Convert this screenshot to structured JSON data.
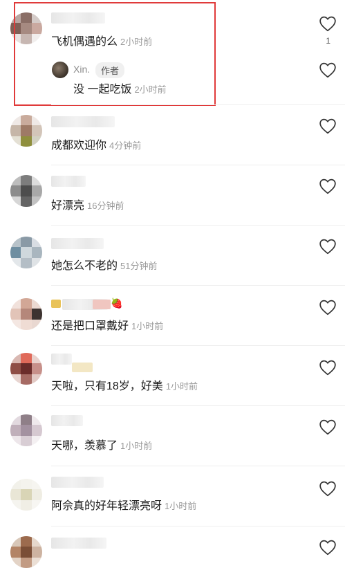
{
  "comments": [
    {
      "text": "飞机偶遇的么",
      "time": "2小时前",
      "likes": "1"
    },
    {
      "text": "成都欢迎你",
      "time": "4分钟前"
    },
    {
      "text": "好漂亮",
      "time": "16分钟前"
    },
    {
      "text": "她怎么不老的",
      "time": "51分钟前"
    },
    {
      "text": "还是把口罩戴好",
      "time": "1小时前"
    },
    {
      "text": "天啦，只有18岁，好美",
      "time": "1小时前"
    },
    {
      "text": "天哪，羡慕了",
      "time": "1小时前"
    },
    {
      "text": "阿佘真的好年轻漂亮呀",
      "time": "1小时前"
    }
  ],
  "reply": {
    "name": "Xin.",
    "tag": "作者",
    "text": "没 一起吃饭",
    "time": "2小时前"
  },
  "icons": {
    "like": "heart-outline-icon"
  },
  "colors": {
    "highlight": "#e03a3a"
  }
}
